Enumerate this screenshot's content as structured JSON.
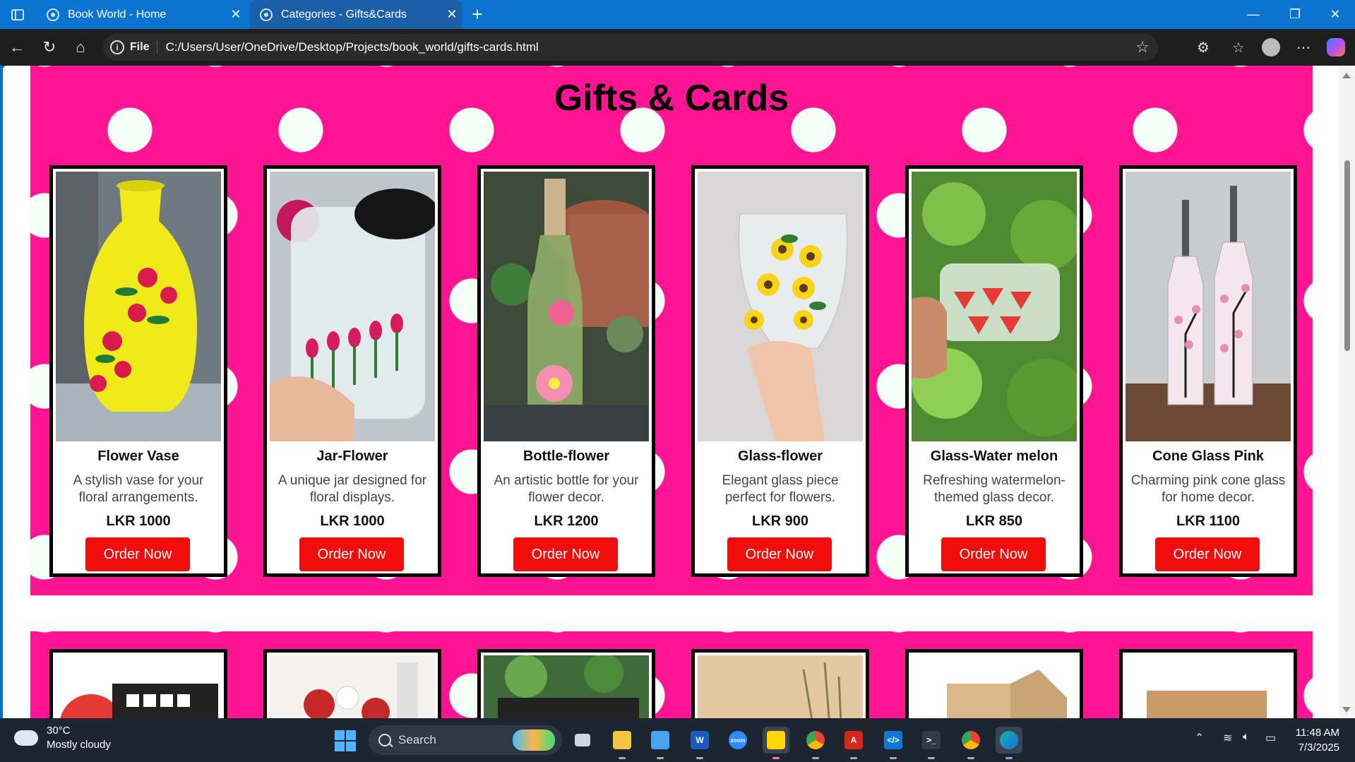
{
  "browser": {
    "tabs": [
      {
        "label": "Book World - Home"
      },
      {
        "label": "Categories - Gifts&Cards"
      }
    ],
    "address": {
      "scheme_label": "File",
      "url": "C:/Users/User/OneDrive/Desktop/Projects/book_world/gifts-cards.html"
    }
  },
  "page": {
    "title": "Gifts & Cards",
    "products": [
      {
        "name": "Flower Vase",
        "description": "A stylish vase for your floral arrangements.",
        "price": "LKR 1000",
        "button": "Order Now"
      },
      {
        "name": "Jar-Flower",
        "description": "A unique jar designed for floral displays.",
        "price": "LKR 1000",
        "button": "Order Now"
      },
      {
        "name": "Bottle-flower",
        "description": "An artistic bottle for your flower decor.",
        "price": "LKR 1200",
        "button": "Order Now"
      },
      {
        "name": "Glass-flower",
        "description": "Elegant glass piece perfect for flowers.",
        "price": "LKR 900",
        "button": "Order Now"
      },
      {
        "name": "Glass-Water melon",
        "description": "Refreshing watermelon-themed glass decor.",
        "price": "LKR 850",
        "button": "Order Now"
      },
      {
        "name": "Cone Glass Pink",
        "description": "Charming pink cone glass for home decor.",
        "price": "LKR 1100",
        "button": "Order Now"
      }
    ],
    "colors": {
      "section_background": "#ff1493",
      "polka_dot": "#f4fff8",
      "order_button": "#f20c0c"
    }
  },
  "taskbar": {
    "weather": {
      "temperature": "30°C",
      "condition": "Mostly cloudy"
    },
    "search_placeholder": "Search",
    "apps": [
      "file-explorer",
      "explorer",
      "notepad",
      "word",
      "zoom",
      "sticky-notes",
      "chrome",
      "acrobat",
      "vscode",
      "terminal",
      "chrome-profile",
      "edge"
    ],
    "clock": {
      "time": "11:48 AM",
      "date": "7/3/2025"
    }
  }
}
